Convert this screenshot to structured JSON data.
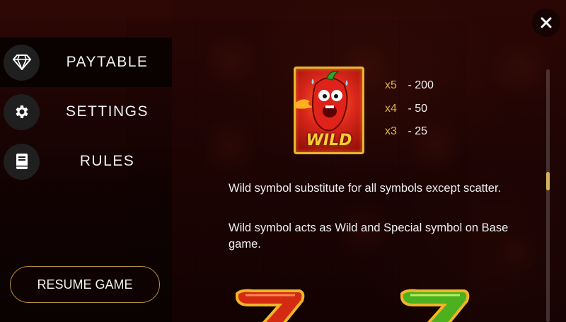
{
  "menu": {
    "items": [
      {
        "label": "PAYTABLE",
        "icon": "diamond-icon",
        "active": true
      },
      {
        "label": "SETTINGS",
        "icon": "gear-icon",
        "active": false
      },
      {
        "label": "RULES",
        "icon": "book-icon",
        "active": false
      }
    ],
    "resume_label": "RESUME GAME"
  },
  "close": {
    "icon": "close-icon"
  },
  "paytable": {
    "wild": {
      "label": "WILD",
      "payouts": [
        {
          "mult": "x5",
          "amount": "- 200"
        },
        {
          "mult": "x4",
          "amount": "- 50"
        },
        {
          "mult": "x3",
          "amount": "- 25"
        }
      ]
    },
    "descriptions": [
      "Wild symbol substitute for all symbols except scatter.",
      "Wild symbol acts as Wild and Special symbol on Base game."
    ]
  },
  "colors": {
    "accent_gold": "#e3b441",
    "resume_border": "#b58f3c",
    "scroll_thumb": "#d6b25a"
  }
}
